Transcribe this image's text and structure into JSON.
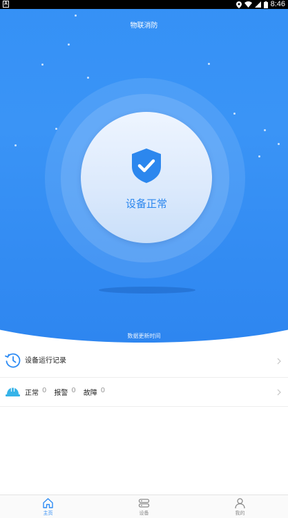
{
  "status_bar": {
    "time": "8:46",
    "left_icon": "A"
  },
  "header": {
    "title": "物联消防"
  },
  "status_circle": {
    "icon": "shield-check-icon",
    "status_text": "设备正常",
    "update_label": "数据更新时间"
  },
  "list": {
    "run_records": {
      "icon": "history-icon",
      "label": "设备运行记录"
    },
    "summary": {
      "icon": "helmet-icon",
      "items": [
        {
          "label": "正常",
          "value": "0"
        },
        {
          "label": "报警",
          "value": "0"
        },
        {
          "label": "故障",
          "value": "0"
        }
      ]
    }
  },
  "tab_bar": {
    "tabs": [
      {
        "label": "主页",
        "icon": "home-icon",
        "active": true
      },
      {
        "label": "设备",
        "icon": "device-icon",
        "active": false
      },
      {
        "label": "我的",
        "icon": "user-icon",
        "active": false
      }
    ]
  },
  "colors": {
    "primary": "#2d8bf4",
    "status_text": "#2c87ee"
  }
}
